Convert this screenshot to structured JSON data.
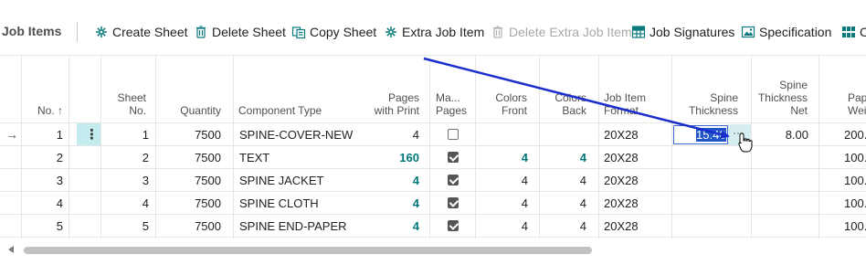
{
  "page": {
    "title": "Job Items"
  },
  "toolbar": {
    "actions": [
      {
        "label": "Create Sheet",
        "icon": "sheet-star-icon",
        "enabled": true
      },
      {
        "label": "Delete Sheet",
        "icon": "trash-icon",
        "enabled": true
      },
      {
        "label": "Copy Sheet",
        "icon": "copy-icon",
        "enabled": true
      },
      {
        "label": "Extra Job Item",
        "icon": "sheet-star-icon",
        "enabled": true
      },
      {
        "label": "Delete Extra Job Item",
        "icon": "trash-icon",
        "enabled": false
      },
      {
        "label": "Job Signatures",
        "icon": "signature-grid-icon",
        "enabled": true
      },
      {
        "label": "Specification",
        "icon": "picture-icon",
        "enabled": true
      },
      {
        "label": "Co",
        "icon": "grid-icon",
        "enabled": true
      }
    ]
  },
  "columns": {
    "no": "No. ↑",
    "sheet_no_1": "Sheet",
    "sheet_no_2": "No.",
    "quantity": "Quantity",
    "component_type": "Component Type",
    "pages_print_1": "Pages",
    "pages_print_2": "with Print",
    "manual_pages_1": "Ma...",
    "manual_pages_2": "Pages",
    "colors_front_1": "Colors",
    "colors_front_2": "Front",
    "colors_back_1": "Colors",
    "colors_back_2": "Back",
    "format_1": "Job Item",
    "format_2": "Format",
    "spine_1": "Spine",
    "spine_2": "Thickness",
    "spine_net_1": "Spine",
    "spine_net_2": "Thickness",
    "spine_net_3": "Net",
    "paper_weight_1": "Pap",
    "paper_weight_2": "Weigh"
  },
  "rows": [
    {
      "no": "1",
      "sheet": "1",
      "qty": "7500",
      "component": "SPINE-COVER-NEW",
      "pages": "4",
      "manual": false,
      "front": "",
      "back": "",
      "format": "20X28",
      "spine": "15.40",
      "spine_net": "8.00",
      "paper": "200.",
      "selected": true
    },
    {
      "no": "2",
      "sheet": "2",
      "qty": "7500",
      "component": "TEXT",
      "pages": "160",
      "manual": true,
      "front": "4",
      "back": "4",
      "format": "20X28",
      "spine": "",
      "spine_net": "",
      "paper": "100.",
      "selected": false
    },
    {
      "no": "3",
      "sheet": "3",
      "qty": "7500",
      "component": "SPINE JACKET",
      "pages": "4",
      "manual": true,
      "front": "4",
      "back": "4",
      "format": "20X28",
      "spine": "",
      "spine_net": "",
      "paper": "100.",
      "selected": false
    },
    {
      "no": "4",
      "sheet": "4",
      "qty": "7500",
      "component": "SPINE CLOTH",
      "pages": "4",
      "manual": true,
      "front": "4",
      "back": "4",
      "format": "20X28",
      "spine": "",
      "spine_net": "",
      "paper": "100.",
      "selected": false
    },
    {
      "no": "5",
      "sheet": "5",
      "qty": "7500",
      "component": "SPINE END-PAPER",
      "pages": "4",
      "manual": true,
      "front": "4",
      "back": "4",
      "format": "20X28",
      "spine": "",
      "spine_net": "",
      "paper": "100.",
      "selected": false
    }
  ],
  "row_actions_glyph": "⋮",
  "assist_glyph": "···",
  "current_row_glyph": "→",
  "colors": {
    "accent": "#00787a",
    "selection": "#1e4eb4",
    "annotation": "#1a2ecc"
  }
}
